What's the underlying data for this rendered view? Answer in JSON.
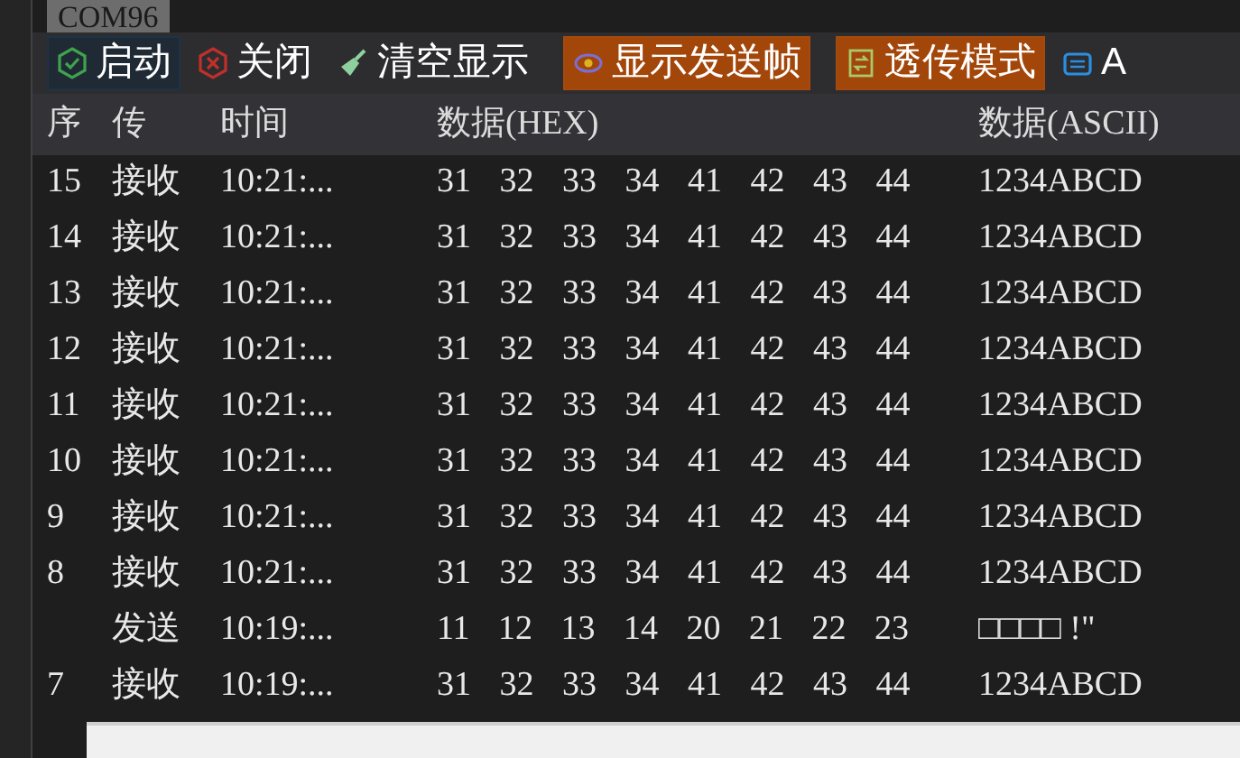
{
  "tab": {
    "label": "COM96"
  },
  "toolbar": [
    {
      "kind": "start",
      "label": "启动",
      "on": true
    },
    {
      "kind": "close",
      "label": "关闭",
      "on": false
    },
    {
      "kind": "clear",
      "label": "清空显示",
      "on": false
    },
    {
      "kind": "show",
      "label": "显示发送帧",
      "on": true
    },
    {
      "kind": "passthrough",
      "label": "透传模式",
      "on": true
    },
    {
      "kind": "auto",
      "label": "A",
      "on": false
    }
  ],
  "table": {
    "columns": [
      "序",
      "传",
      "时间",
      "数据(HEX)",
      "数据(ASCII)"
    ],
    "rows": [
      [
        "15",
        "接收",
        "10:21:...",
        "31 32 33 34 41 42 43 44",
        "1234ABCD"
      ],
      [
        "14",
        "接收",
        "10:21:...",
        "31 32 33 34 41 42 43 44",
        "1234ABCD"
      ],
      [
        "13",
        "接收",
        "10:21:...",
        "31 32 33 34 41 42 43 44",
        "1234ABCD"
      ],
      [
        "12",
        "接收",
        "10:21:...",
        "31 32 33 34 41 42 43 44",
        "1234ABCD"
      ],
      [
        "11",
        "接收",
        "10:21:...",
        "31 32 33 34 41 42 43 44",
        "1234ABCD"
      ],
      [
        "10",
        "接收",
        "10:21:...",
        "31 32 33 34 41 42 43 44",
        "1234ABCD"
      ],
      [
        "9",
        "接收",
        "10:21:...",
        "31 32 33 34 41 42 43 44",
        "1234ABCD"
      ],
      [
        "8",
        "接收",
        "10:21:...",
        "31 32 33 34 41 42 43 44",
        "1234ABCD"
      ],
      [
        "",
        "发送",
        "10:19:...",
        "11 12 13 14 20 21 22 23",
        "□□□□ !\""
      ],
      [
        "7",
        "接收",
        "10:19:...",
        "31 32 33 34 41 42 43 44",
        "1234ABCD"
      ]
    ]
  }
}
